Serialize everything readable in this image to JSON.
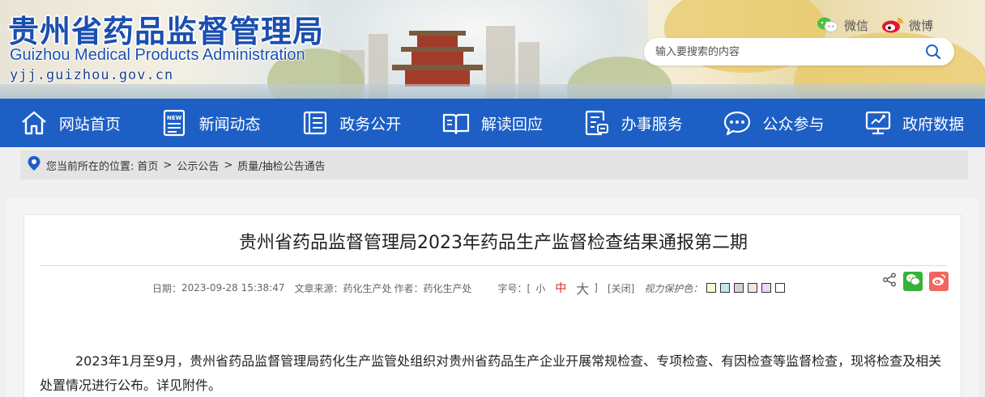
{
  "header": {
    "title_cn": "贵州省药品监督管理局",
    "title_en": "Guizhou Medical Products Administration",
    "url": "yjj.guizhou.gov.cn",
    "social": [
      {
        "label": "微信",
        "icon": "wechat-icon"
      },
      {
        "label": "微博",
        "icon": "weibo-icon"
      }
    ],
    "search_placeholder": "输入要搜索的内容"
  },
  "nav": {
    "items": [
      {
        "label": "网站首页",
        "icon": "home-icon"
      },
      {
        "label": "新闻动态",
        "icon": "news-icon"
      },
      {
        "label": "政务公开",
        "icon": "document-icon"
      },
      {
        "label": "解读回应",
        "icon": "book-icon"
      },
      {
        "label": "办事服务",
        "icon": "service-icon"
      },
      {
        "label": "公众参与",
        "icon": "chat-icon"
      },
      {
        "label": "政府数据",
        "icon": "data-icon"
      }
    ],
    "bg_color": "#1d5fc5"
  },
  "breadcrumb": {
    "prefix": "您当前所在的位置:",
    "items": [
      "首页",
      "公示公告",
      "质量/抽检公告通告"
    ],
    "separator": ">"
  },
  "article": {
    "title": "贵州省药品监督管理局2023年药品生产监督检查结果通报第二期",
    "date_label": "日期：",
    "date": "2023-09-28 15:38:47",
    "source_label": "文章来源：",
    "source": "药化生产处",
    "author_label": "作者：",
    "author": "药化生产处",
    "font_size_label": "字号：[",
    "font_small": "小",
    "font_mid": "中",
    "font_big": "大",
    "font_size_close": "]",
    "close_label": "[关闭]",
    "vision_label": "视力保护色：",
    "vision_colors": [
      "#fafad2",
      "#c2e7f0",
      "#d3d3d3",
      "#ffe0e0",
      "#e8d8ff",
      "#ffffff"
    ],
    "body": "2023年1月至9月，贵州省药品监督管理局药化生产监管处组织对贵州省药品生产企业开展常规检查、专项检查、有因检查等监督检查，现将检查及相关处置情况进行公布。详见附件。"
  }
}
